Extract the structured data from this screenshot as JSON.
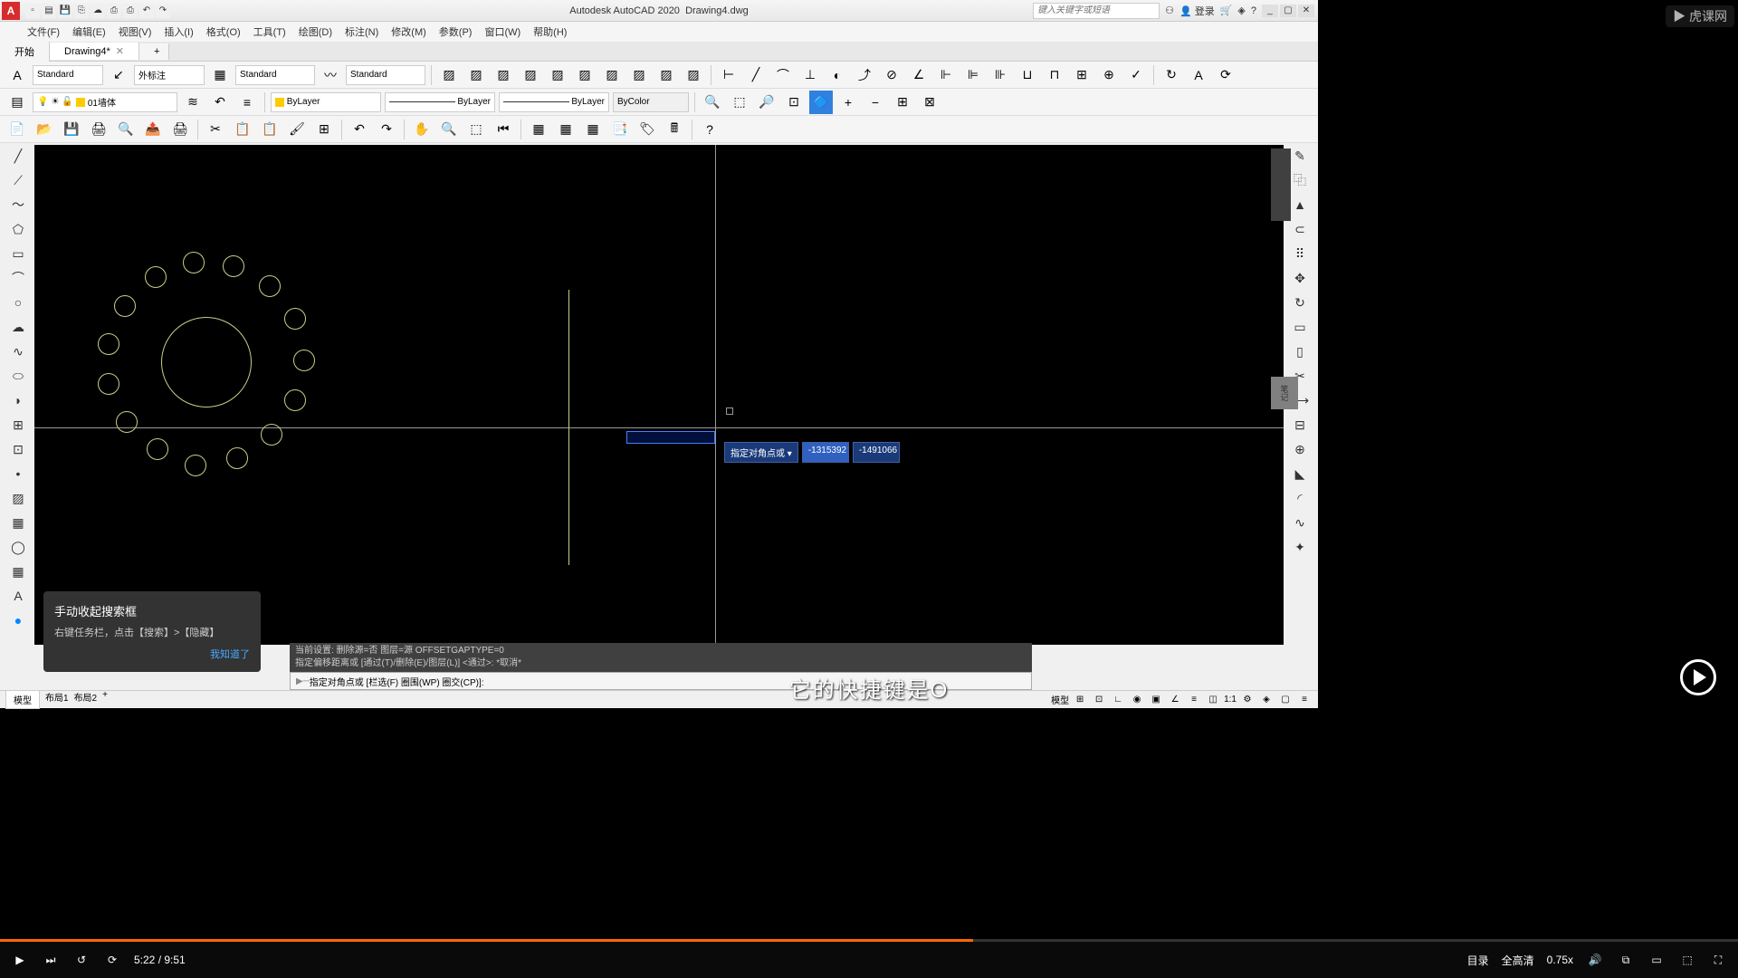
{
  "title": {
    "app": "Autodesk AutoCAD 2020",
    "file": "Drawing4.dwg"
  },
  "search_placeholder": "键入关键字或短语",
  "login": "登录",
  "menus": [
    "文件(F)",
    "编辑(E)",
    "视图(V)",
    "插入(I)",
    "格式(O)",
    "工具(T)",
    "绘图(D)",
    "标注(N)",
    "修改(M)",
    "参数(P)",
    "窗口(W)",
    "帮助(H)"
  ],
  "tabs": {
    "start": "开始",
    "drawing": "Drawing4*"
  },
  "dropdowns": {
    "textstyle": "Standard",
    "dimstyle": "外标注",
    "tablestyle": "Standard",
    "mlstyle": "Standard"
  },
  "layer": {
    "name": "01墙体",
    "bylayer": "ByLayer",
    "bycolor": "ByColor"
  },
  "dyn": {
    "label": "指定对角点或",
    "x": "-1315392",
    "y": "-1491066"
  },
  "cmd_history": {
    "l1": "当前设置: 删除源=否  图层=源  OFFSETGAPTYPE=0",
    "l2": "指定偏移距离或 [通过(T)/删除(E)/图层(L)] <通过>:  *取消*"
  },
  "cmd_prompt": "指定对角点或 [栏选(F) 圈围(WP) 圈交(CP)]:",
  "tooltip": {
    "title": "手动收起搜索框",
    "body": "右键任务栏，点击【搜索】>【隐藏】",
    "ok": "我知道了"
  },
  "status": {
    "model": "模型",
    "layout1": "布局1",
    "layout2": "布局2",
    "modelr": "模型",
    "scale": "1:1"
  },
  "subtitle": "它的快捷键是O",
  "watermark": "虎课网",
  "notes_label": "笔记",
  "video": {
    "time": "5:22 / 9:51",
    "toc": "目录",
    "quality": "全高清",
    "speed": "0.75x"
  }
}
